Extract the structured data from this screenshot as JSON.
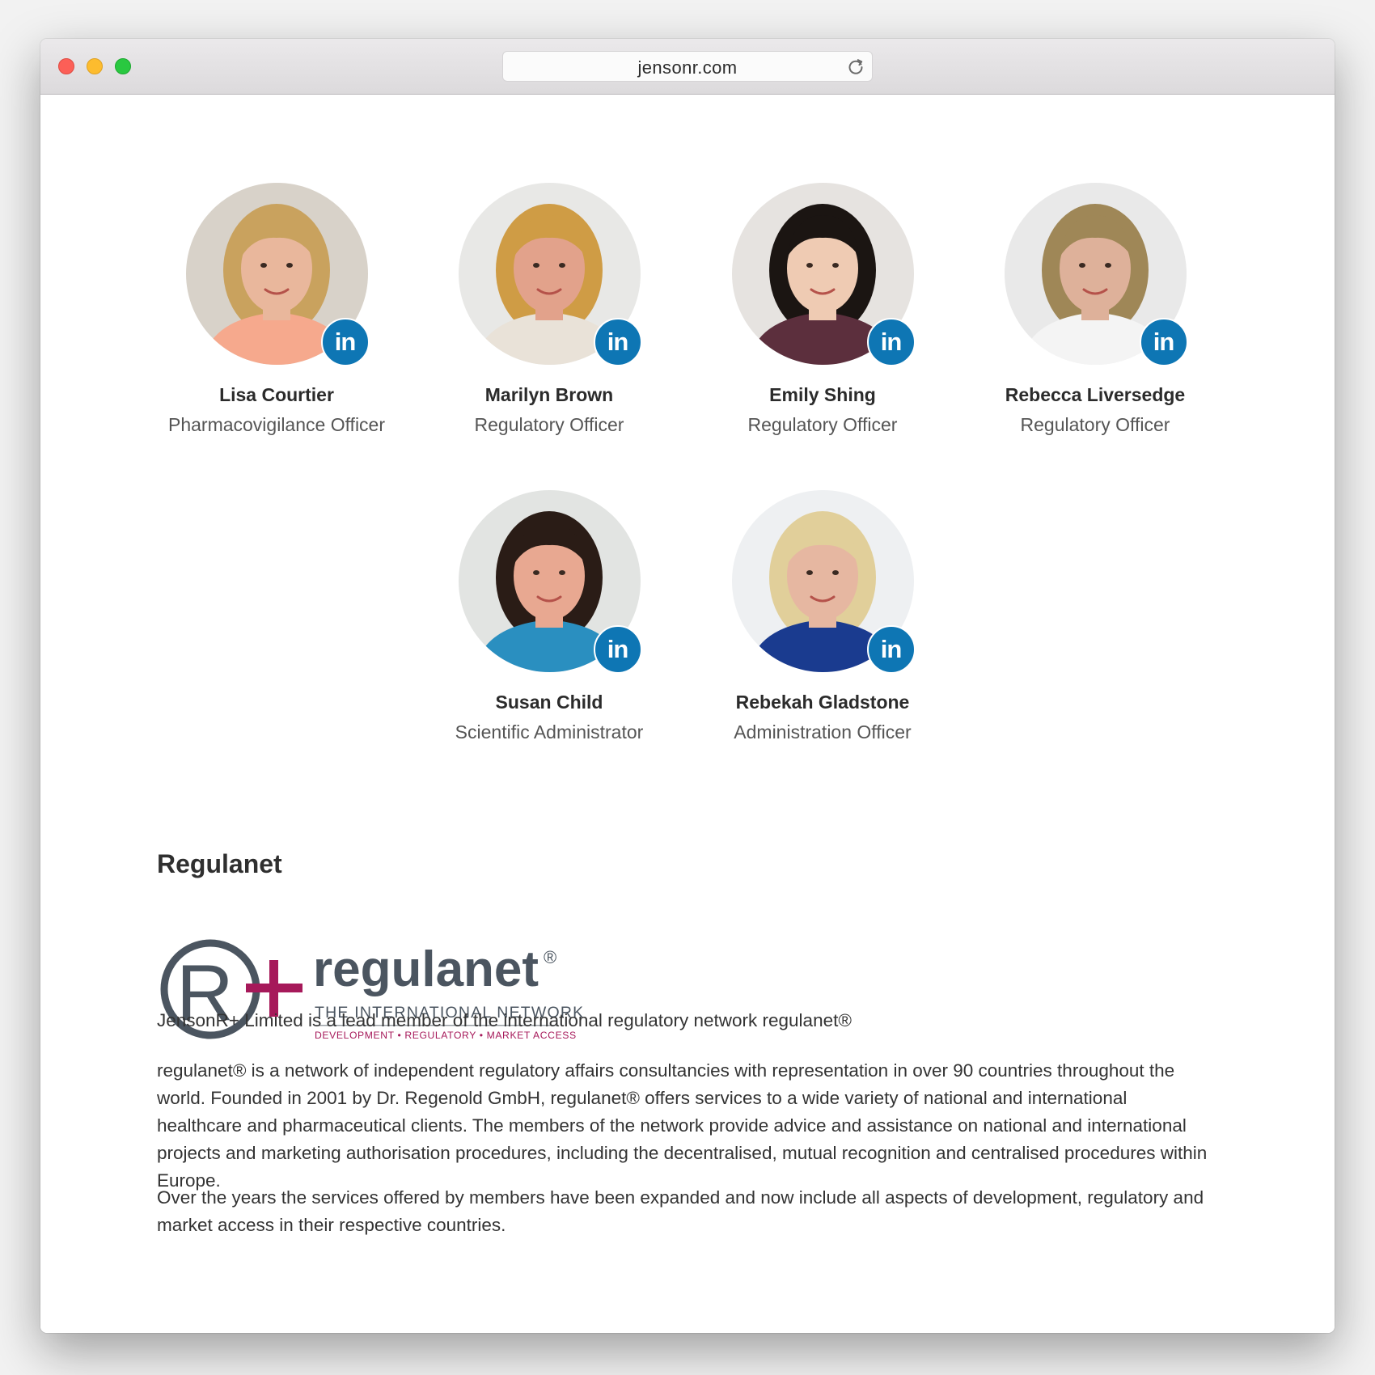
{
  "browser": {
    "url": "jensonr.com"
  },
  "team": [
    {
      "name": "Lisa Courtier",
      "role": "Pharmacovigilance Officer",
      "linkedin": "in",
      "skin": "#e9b79c",
      "hair": "#c9a25e",
      "shirt": "#f6a98d",
      "bg": "#d8d2c9"
    },
    {
      "name": "Marilyn Brown",
      "role": "Regulatory Officer",
      "linkedin": "in",
      "skin": "#e2a28b",
      "hair": "#cf9c45",
      "shirt": "#e9e2d8",
      "bg": "#e8e8e6"
    },
    {
      "name": "Emily Shing",
      "role": "Regulatory Officer",
      "linkedin": "in",
      "skin": "#efcbb3",
      "hair": "#1b1512",
      "shirt": "#5c2f3d",
      "bg": "#e6e3e0"
    },
    {
      "name": "Rebecca Liversedge",
      "role": "Regulatory Officer",
      "linkedin": "in",
      "skin": "#deb19a",
      "hair": "#9f8757",
      "shirt": "#f4f4f4",
      "bg": "#e9e9e9"
    },
    {
      "name": "Susan Child",
      "role": "Scientific Administrator",
      "linkedin": "in",
      "skin": "#e8a891",
      "hair": "#2a1c16",
      "shirt": "#2a8fc0",
      "bg": "#e2e4e2"
    },
    {
      "name": "Rebekah Gladstone",
      "role": "Administration Officer",
      "linkedin": "in",
      "skin": "#e6b7a1",
      "hair": "#e1cf9a",
      "shirt": "#1a3b8f",
      "bg": "#eef0f2"
    }
  ],
  "regulanet": {
    "heading": "Regulanet",
    "logo": {
      "wordmark": "regulanet",
      "registered": "®",
      "tagline": "THE INTERNATIONAL NETWORK",
      "subline": "DEVELOPMENT • REGULATORY • MARKET ACCESS",
      "color_dark": "#4b5560",
      "color_accent": "#a6195a"
    },
    "paragraphs": [
      "JensonR+ Limited is a lead member of the international regulatory network regulanet®",
      "regulanet® is a network of independent regulatory affairs consultancies with representation in over 90 countries throughout the world. Founded in 2001 by Dr. Regenold GmbH, regulanet® offers services to a wide variety of national and international healthcare and pharmaceutical clients. The members of the network provide advice and assistance on national and international projects and marketing authorisation procedures, including the decentralised, mutual recognition and centralised procedures within Europe.",
      "Over the years the services offered by members have been expanded and now include all aspects of development, regulatory and market access in their respective countries."
    ]
  }
}
